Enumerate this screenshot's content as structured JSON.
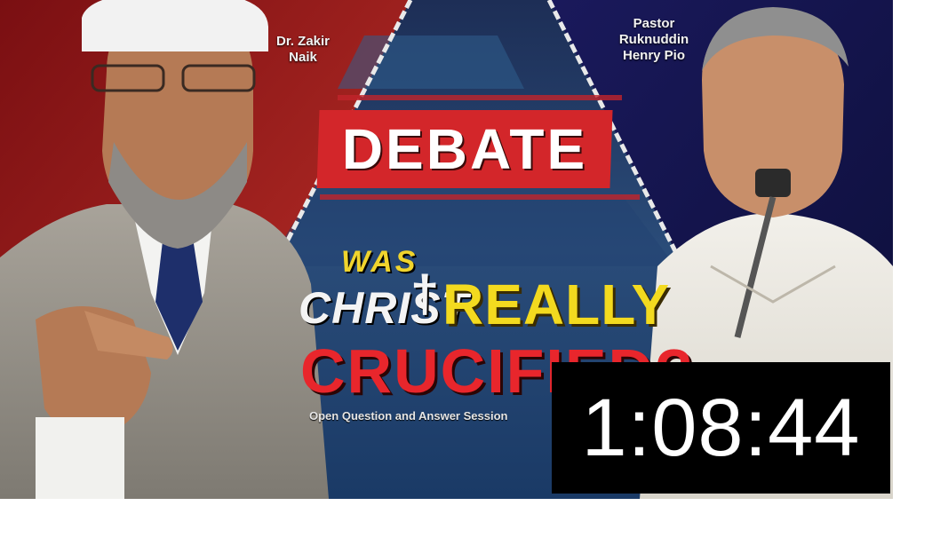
{
  "thumbnail": {
    "speakers": {
      "left": [
        "Dr. Zakir",
        "Naik"
      ],
      "right": [
        "Pastor",
        "Ruknuddin",
        "Henry Pio"
      ]
    },
    "banner": "DEBATE",
    "title": {
      "was": "WAS",
      "christ": "CHRIST",
      "cross": "†",
      "really": "REALLY",
      "crucified": "CRUCIFIED?"
    },
    "subtitle": "Open Question and Answer Session",
    "duration": "1:08:44"
  }
}
